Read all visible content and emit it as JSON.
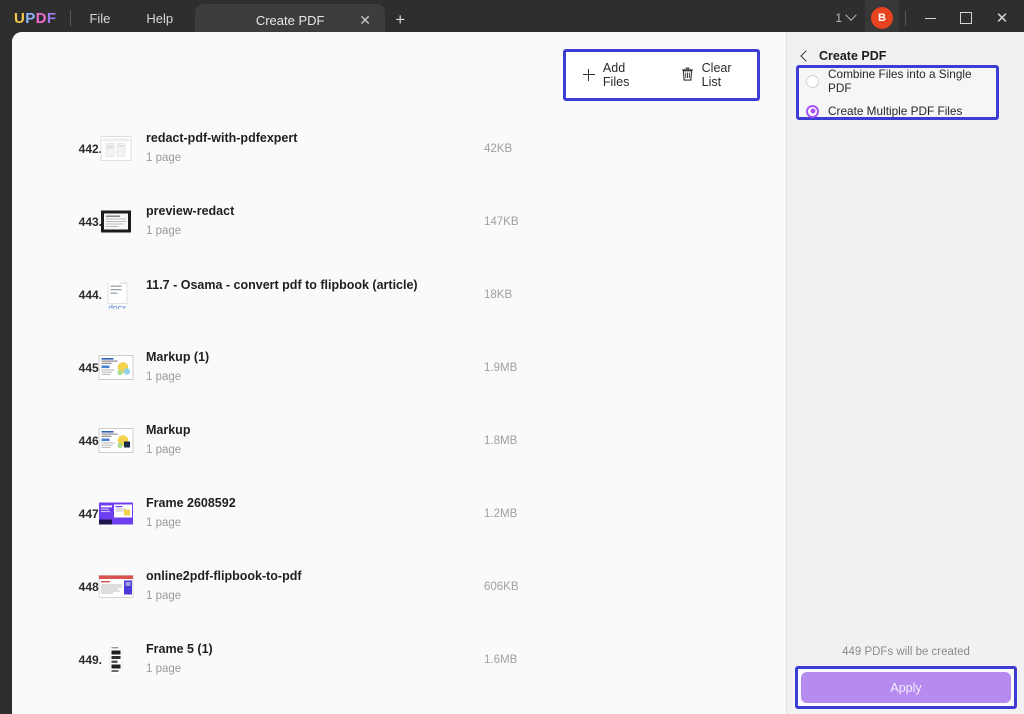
{
  "titlebar": {
    "logo": {
      "l1": "U",
      "l2": "P",
      "l3": "D",
      "l4": "F"
    },
    "menus": [
      {
        "label": "File"
      },
      {
        "label": "Help"
      }
    ],
    "tab": {
      "label": "Create PDF",
      "close_icon": "close-icon"
    },
    "new_tab_icon": "plus-icon",
    "page_count": "1",
    "avatar_initial": "B",
    "window_controls": {
      "minimize": "minimize-icon",
      "maximize": "maximize-icon",
      "close": "close-icon"
    }
  },
  "toolbar": {
    "add_files_label": "Add Files",
    "clear_list_label": "Clear List",
    "highlight_color": "#3d3dd4"
  },
  "filelist": [
    {
      "index": "442.",
      "name": "redact-pdf-with-pdfexpert",
      "pages": "1 page",
      "size": "42KB",
      "thumb": "doc-redact"
    },
    {
      "index": "443.",
      "name": "preview-redact",
      "pages": "1 page",
      "size": "147KB",
      "thumb": "doc-dark"
    },
    {
      "index": "444.",
      "name": "11.7 - Osama - convert pdf to flipbook (article)",
      "pages": "",
      "size": "18KB",
      "thumb": "docx",
      "ext_label": ".docx"
    },
    {
      "index": "445.",
      "name": "Markup (1)",
      "pages": "1 page",
      "size": "1.9MB",
      "thumb": "doc-markup"
    },
    {
      "index": "446.",
      "name": "Markup",
      "pages": "1 page",
      "size": "1.8MB",
      "thumb": "doc-markup"
    },
    {
      "index": "447.",
      "name": "Frame 2608592",
      "pages": "1 page",
      "size": "1.2MB",
      "thumb": "doc-purple"
    },
    {
      "index": "448.",
      "name": "online2pdf-flipbook-to-pdf",
      "pages": "1 page",
      "size": "606KB",
      "thumb": "doc-web"
    },
    {
      "index": "449.",
      "name": "Frame 5 (1)",
      "pages": "1 page",
      "size": "1.6MB",
      "thumb": "doc-tall"
    }
  ],
  "right_panel": {
    "title": "Create PDF",
    "back_icon": "chevron-left-icon",
    "options": [
      {
        "label": "Combine Files into a Single PDF",
        "selected": false
      },
      {
        "label": "Create Multiple PDF Files",
        "selected": true
      }
    ],
    "note": "449 PDFs will be created",
    "apply_label": "Apply",
    "accent_color": "#a855f7",
    "highlight_color": "#3d3dd4"
  }
}
